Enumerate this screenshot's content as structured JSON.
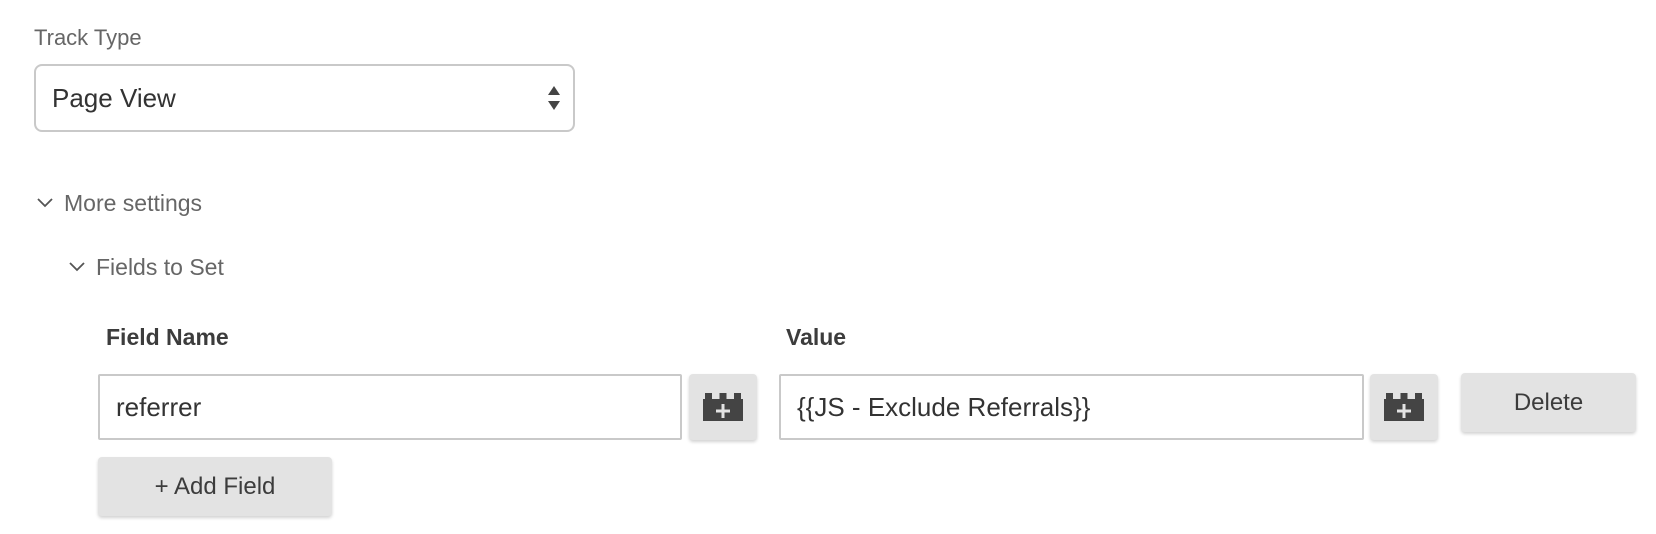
{
  "track_type": {
    "label": "Track Type",
    "selected": "Page View",
    "icon": "select-updown-icon"
  },
  "more_settings": {
    "label": "More settings",
    "icon": "chevron-down-icon"
  },
  "fields_to_set": {
    "label": "Fields to Set",
    "icon": "chevron-down-icon",
    "headers": {
      "field_name": "Field Name",
      "value": "Value"
    },
    "rows": [
      {
        "field_name": "referrer",
        "value": "{{JS - Exclude Referrals}}",
        "delete_label": "Delete"
      }
    ],
    "variable_icon": "variable-brick-icon",
    "add_label": "+ Add Field"
  },
  "colors": {
    "button_bg": "#e3e3e3",
    "border": "#c9c9c9",
    "icon": "#444444"
  }
}
